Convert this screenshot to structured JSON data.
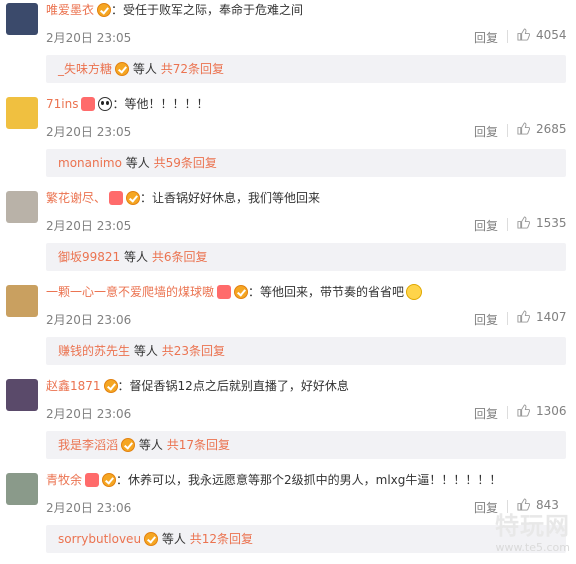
{
  "comments": [
    {
      "username": "唯爱墨衣",
      "badges": [
        "v"
      ],
      "text": "：受任于败军之际，奉命于危难之间",
      "date": "2月20日 23:05",
      "reply": "回复",
      "likes": "4054",
      "sub_user": "_失味方糖",
      "sub_user_badges": [
        "v"
      ],
      "sub_mid": "等人",
      "sub_count": "共72条回复",
      "avatar_color": "#3b4a6b"
    },
    {
      "username": "71ins",
      "badges": [
        "heart",
        "panda"
      ],
      "text": "：等他！！！！！",
      "date": "2月20日 23:05",
      "reply": "回复",
      "likes": "2685",
      "sub_user": "monanimo",
      "sub_user_badges": [],
      "sub_mid": "等人",
      "sub_count": "共59条回复",
      "avatar_color": "#f0c040"
    },
    {
      "username": "繁花谢尽、",
      "badges": [
        "heart",
        "v"
      ],
      "text": "：让香锅好好休息，我们等他回来",
      "date": "2月20日 23:05",
      "reply": "回复",
      "likes": "1535",
      "sub_user": "御坂99821",
      "sub_user_badges": [],
      "sub_mid": "等人",
      "sub_count": "共6条回复",
      "avatar_color": "#b9b2a8"
    },
    {
      "username": "一颗一心一意不爱爬墙的煤球嗷",
      "badges": [
        "heart",
        "v"
      ],
      "text": "：等他回来，带节奏的省省吧",
      "emoji": true,
      "date": "2月20日 23:06",
      "reply": "回复",
      "likes": "1407",
      "sub_user": "赚钱的苏先生",
      "sub_user_badges": [],
      "sub_mid": "等人",
      "sub_count": "共23条回复",
      "avatar_color": "#c9a060"
    },
    {
      "username": "赵鑫1871",
      "badges": [
        "v"
      ],
      "text": "：督促香锅12点之后就别直播了，好好休息",
      "date": "2月20日 23:06",
      "reply": "回复",
      "likes": "1306",
      "sub_user": "我是李滔滔",
      "sub_user_badges": [
        "v"
      ],
      "sub_mid": "等人",
      "sub_count": "共17条回复",
      "avatar_color": "#5a4a6a"
    },
    {
      "username": "青牧余",
      "badges": [
        "heart",
        "v"
      ],
      "text": "：休养可以，我永远愿意等那个2级抓中的男人，mlxg牛逼！！！！！！",
      "date": "2月20日 23:06",
      "reply": "回复",
      "likes": "843",
      "sub_user": "sorrybutloveu",
      "sub_user_badges": [
        "v"
      ],
      "sub_mid": "等人",
      "sub_count": "共12条回复",
      "avatar_color": "#8a9a8a"
    }
  ],
  "watermark": {
    "big": "特玩网",
    "small": "www.te5.com"
  },
  "icons": {
    "like": "thumbs-up-icon",
    "verified": "verified-badge-icon",
    "heart": "heart-badge-icon",
    "panda": "panda-emoji-icon",
    "grin": "grin-emoji-icon"
  },
  "colors": {
    "username": "#eb7350",
    "meta": "#808080",
    "sub_bg": "#f2f2f5"
  }
}
